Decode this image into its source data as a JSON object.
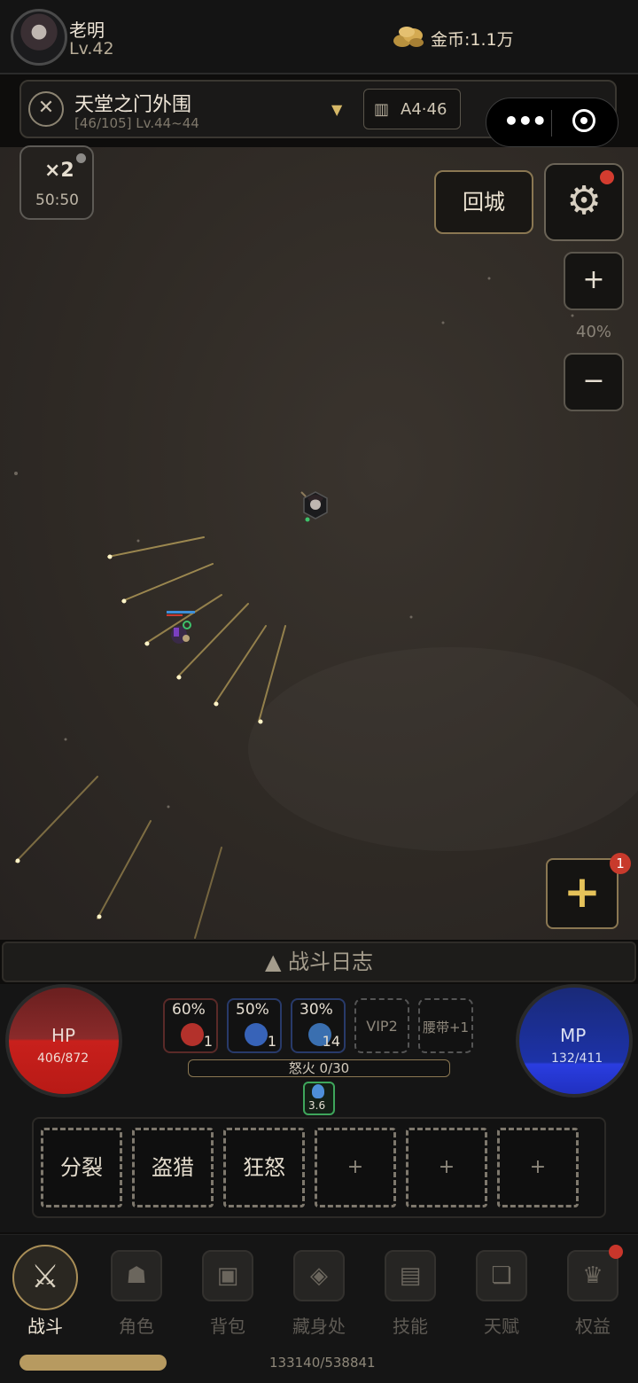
{
  "player": {
    "name": "老明",
    "level": "Lv.42"
  },
  "gold": {
    "label": "金币:1.1万",
    "icon": "gold-coins-icon"
  },
  "map": {
    "name": "天堂之门外围",
    "sub": "[46/105] Lv.44~44",
    "coord": "A4·46"
  },
  "speed": {
    "multiplier": "×2",
    "timer": "50:50"
  },
  "buttons": {
    "return_city": "回城",
    "zoom_in": "+",
    "zoom_out": "−",
    "zoom_level": "40%",
    "add": "+",
    "add_badge": "1"
  },
  "battle_log": "▲ 战斗日志",
  "hp": {
    "label": "HP",
    "value": "406/872"
  },
  "mp": {
    "label": "MP",
    "value": "132/411"
  },
  "quick_slots": [
    {
      "pct": "60%",
      "count": "1",
      "color": "#b3312b"
    },
    {
      "pct": "50%",
      "count": "1",
      "color": "#3763b8"
    },
    {
      "pct": "30%",
      "count": "14",
      "color": "#3a6fb0"
    },
    {
      "text": "VIP2"
    },
    {
      "text": "腰带+1"
    }
  ],
  "rage": "怒火 0/30",
  "buff": {
    "value": "3.6"
  },
  "skills": [
    "分裂",
    "盗猎",
    "狂怒",
    "+",
    "+",
    "+"
  ],
  "nav": [
    {
      "label": "战斗",
      "icon": "crossed-swords-icon",
      "active": true
    },
    {
      "label": "角色",
      "icon": "character-mask-icon"
    },
    {
      "label": "背包",
      "icon": "backpack-chest-icon"
    },
    {
      "label": "藏身处",
      "icon": "hideout-icon"
    },
    {
      "label": "技能",
      "icon": "skill-book-icon"
    },
    {
      "label": "天赋",
      "icon": "talent-scroll-icon"
    },
    {
      "label": "权益",
      "icon": "privilege-crown-icon"
    }
  ],
  "exp": {
    "value": "133140/538841",
    "fill": 0.247
  }
}
